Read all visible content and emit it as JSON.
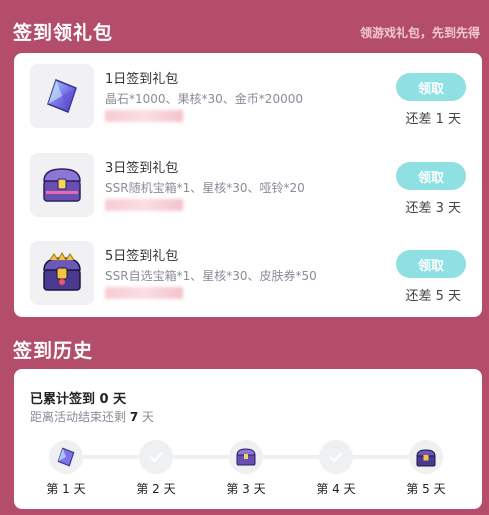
{
  "header": {
    "title": "签到领礼包",
    "subtitle": "领游戏礼包，先到先得"
  },
  "gifts": [
    {
      "title": "1日签到礼包",
      "desc": "晶石*1000、果核*30、金币*20000",
      "button": "领取",
      "remaining": "还差 1 天",
      "icon": "crystal-icon"
    },
    {
      "title": "3日签到礼包",
      "desc": "SSR随机宝箱*1、星核*30、哑铃*20",
      "button": "领取",
      "remaining": "还差 3 天",
      "icon": "treasure-chest-icon"
    },
    {
      "title": "5日签到礼包",
      "desc": "SSR自选宝箱*1、星核*30、皮肤券*50",
      "button": "领取",
      "remaining": "还差 5 天",
      "icon": "gold-chest-icon"
    }
  ],
  "history": {
    "title": "签到历史",
    "signed_prefix": "已累计签到",
    "signed_days": "0",
    "signed_suffix": "天",
    "ends_prefix": "距离活动结束还剩",
    "ends_days": "7",
    "ends_suffix": "天",
    "days": [
      {
        "label": "第 1 天",
        "icon": "crystal-icon"
      },
      {
        "label": "第 2 天",
        "icon": "check-icon"
      },
      {
        "label": "第 3 天",
        "icon": "treasure-chest-icon"
      },
      {
        "label": "第 4 天",
        "icon": "check-icon"
      },
      {
        "label": "第 5 天",
        "icon": "gold-chest-icon"
      }
    ]
  },
  "colors": {
    "background": "#b34d6a",
    "button": "#8ee0e3",
    "card": "#ffffff"
  }
}
